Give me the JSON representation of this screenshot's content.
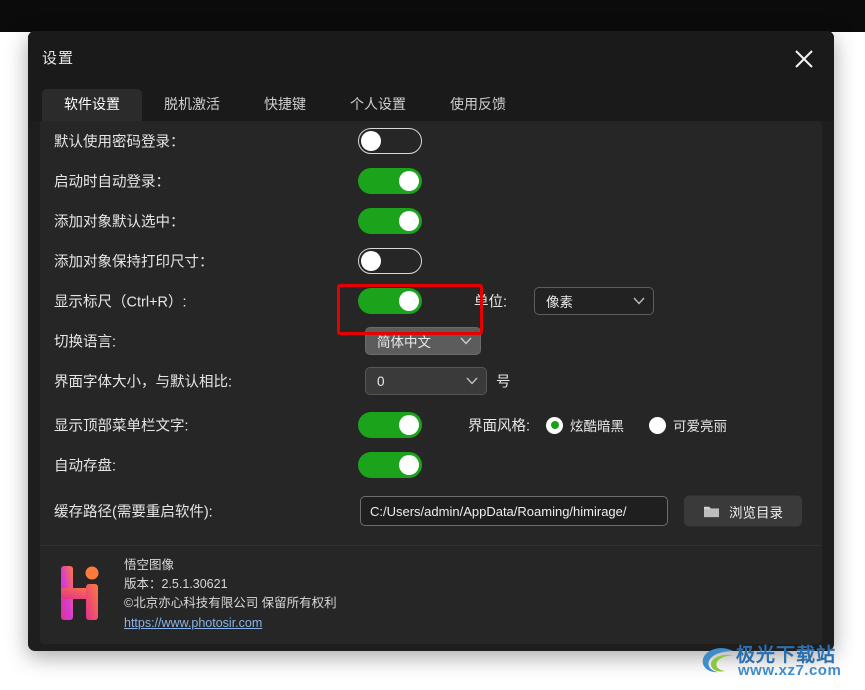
{
  "window": {
    "title": "设置",
    "close_icon": "close-icon"
  },
  "tabs": [
    {
      "label": "软件设置",
      "active": true
    },
    {
      "label": "脱机激活",
      "active": false
    },
    {
      "label": "快捷键",
      "active": false
    },
    {
      "label": "个人设置",
      "active": false
    },
    {
      "label": "使用反馈",
      "active": false
    }
  ],
  "settings": {
    "password_login": {
      "label": "默认使用密码登录：",
      "state": "off"
    },
    "auto_login": {
      "label": "启动时自动登录：",
      "state": "on"
    },
    "object_selected": {
      "label": "添加对象默认选中：",
      "state": "on"
    },
    "keep_print_size": {
      "label": "添加对象保持打印尺寸：",
      "state": "off"
    },
    "show_ruler": {
      "label": "显示标尺（Ctrl+R）:",
      "state": "on",
      "unit_label": "单位:",
      "unit_value": "像素",
      "highlighted": true
    },
    "language": {
      "label": "切换语言:",
      "value": "简体中文"
    },
    "ui_font_size": {
      "label": "界面字体大小，与默认相比:",
      "value": "0",
      "suffix": "号"
    },
    "show_menubar_text": {
      "label": "显示顶部菜单栏文字:",
      "state": "on"
    },
    "ui_style": {
      "label": "界面风格:",
      "options": [
        {
          "label": "炫酷暗黑",
          "selected": true
        },
        {
          "label": "可爱亮丽",
          "selected": false
        }
      ]
    },
    "auto_save": {
      "label": "自动存盘:",
      "state": "on"
    },
    "cache_path": {
      "label": "缓存路径(需要重启软件):",
      "value": "C:/Users/admin/AppData/Roaming/himirage/",
      "browse_label": "浏览目录",
      "browse_icon": "folder-icon"
    }
  },
  "footer": {
    "app_name": "悟空图像",
    "version": "版本：2.5.1.30621",
    "copyright": "©北京亦心科技有限公司 保留所有权利",
    "website": "https://www.photosir.com",
    "logo_icon": "photosir-logo-icon"
  },
  "watermark": {
    "title": "极光下载站",
    "url": "www.xz7.com",
    "logo_icon": "swoosh-logo-icon"
  },
  "colors": {
    "accent_green": "#1ca31c",
    "highlight_red": "#e60000",
    "dialog_bg": "#1e1e1e",
    "panel_bg": "#262626",
    "link_blue": "#8ab4e8"
  }
}
